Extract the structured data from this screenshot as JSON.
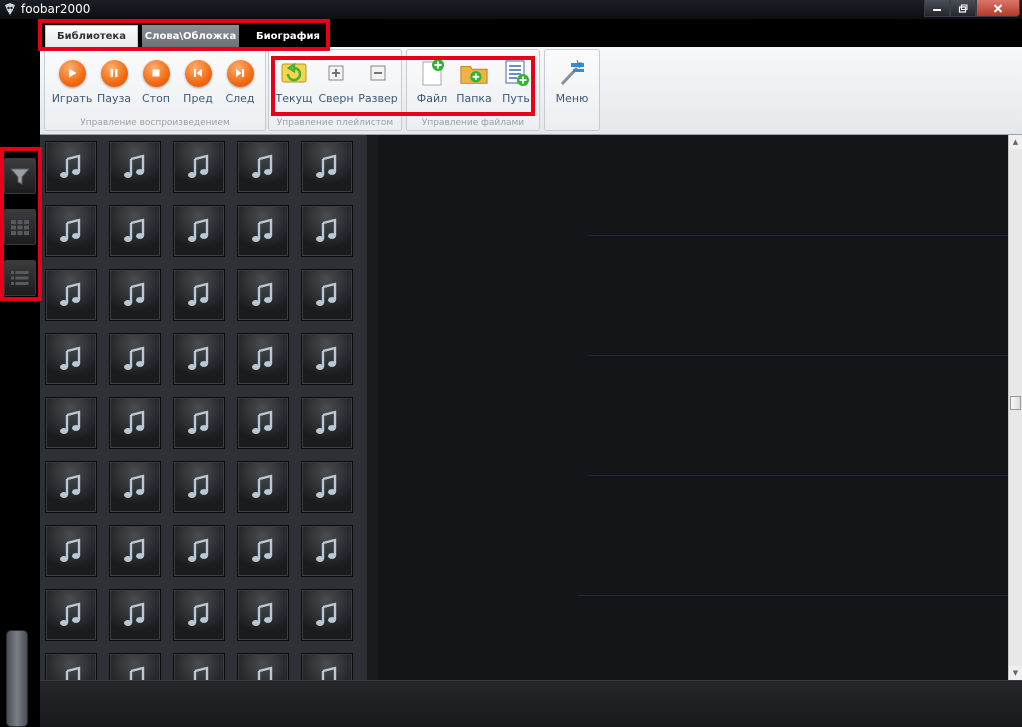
{
  "window": {
    "title": "foobar2000"
  },
  "tabs": [
    {
      "label": "Библиотека"
    },
    {
      "label": "Слова\\Обложка"
    },
    {
      "label": "Биография"
    }
  ],
  "ribbon": {
    "playback": {
      "group_label": "Управление воспроизведением",
      "buttons": [
        {
          "label": "Играть",
          "icon": "play-icon"
        },
        {
          "label": "Пауза",
          "icon": "pause-icon"
        },
        {
          "label": "Стоп",
          "icon": "stop-icon"
        },
        {
          "label": "Пред",
          "icon": "previous-icon"
        },
        {
          "label": "След",
          "icon": "next-icon"
        }
      ]
    },
    "playlist": {
      "group_label": "Управление плейлистом",
      "buttons": [
        {
          "label": "Текущ",
          "icon": "current-playlist-icon"
        },
        {
          "label": "Сверн",
          "icon": "collapse-icon"
        },
        {
          "label": "Развер",
          "icon": "expand-icon"
        }
      ]
    },
    "files": {
      "group_label": "Управление файлами",
      "buttons": [
        {
          "label": "Файл",
          "icon": "add-file-icon"
        },
        {
          "label": "Папка",
          "icon": "add-folder-icon"
        },
        {
          "label": "Путь",
          "icon": "add-path-icon"
        }
      ]
    },
    "menu": {
      "label": "Меню",
      "icon": "menu-wand-icon"
    }
  },
  "sidebar": {
    "buttons": [
      {
        "icon": "filter-icon"
      },
      {
        "icon": "grid-view-icon"
      },
      {
        "icon": "list-view-icon"
      }
    ]
  },
  "album_grid": {
    "thumbnail_icon": "music-note-icon"
  },
  "colors": {
    "highlight": "#e8001a",
    "accent_orange": "#f26a12",
    "label_blue": "#3a5a78"
  }
}
